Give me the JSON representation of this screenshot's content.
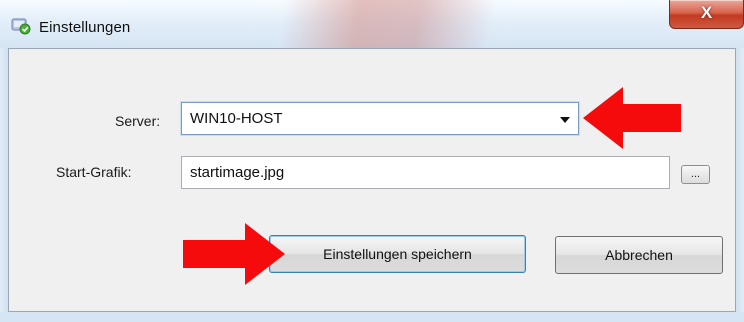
{
  "window": {
    "title": "Einstellungen",
    "close_label": "X"
  },
  "form": {
    "server": {
      "label": "Server:",
      "value": "WIN10-HOST"
    },
    "start_grafik": {
      "label": "Start-Grafik:",
      "value": "startimage.jpg",
      "browse_label": "..."
    }
  },
  "buttons": {
    "save_label": "Einstellungen speichern",
    "cancel_label": "Abbrechen"
  },
  "annotations": {
    "arrow_color": "#f50b0b"
  }
}
